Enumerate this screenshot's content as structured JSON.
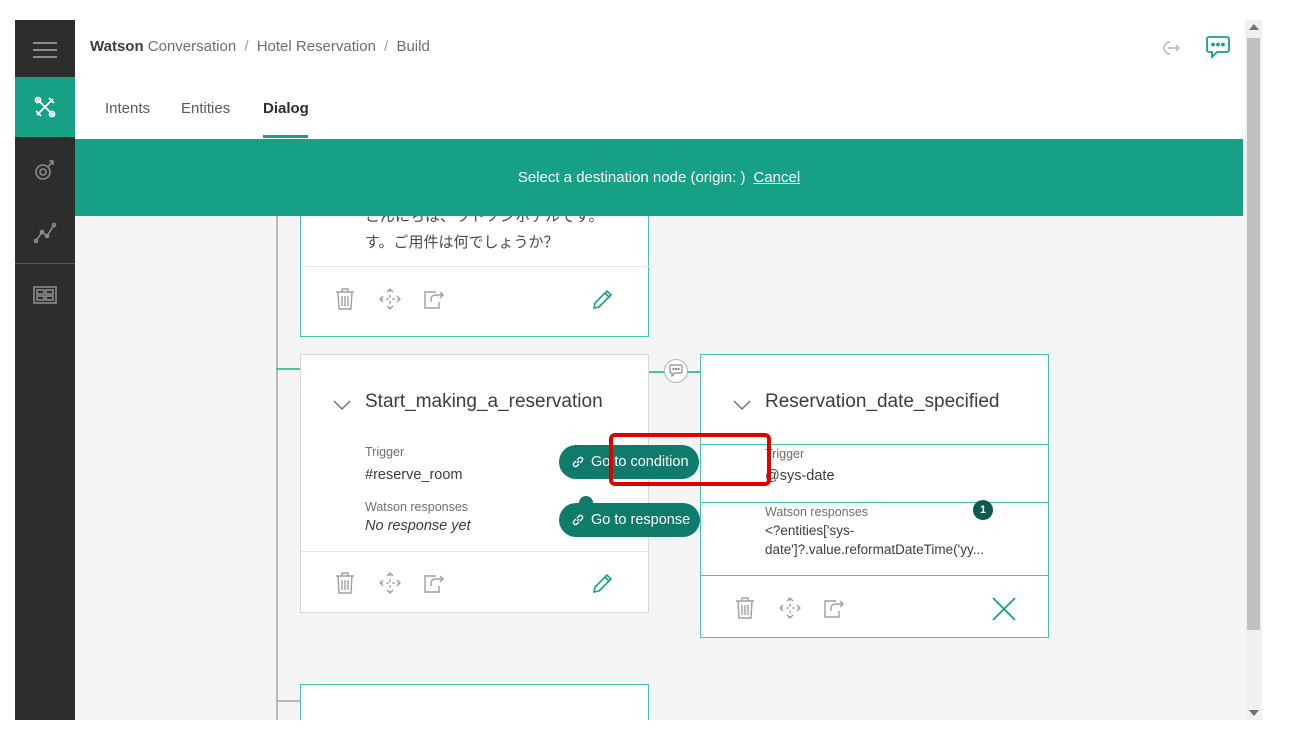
{
  "breadcrumb": {
    "brand": "Watson",
    "product": "Conversation",
    "workspace": "Hotel Reservation",
    "page": "Build",
    "separator": "/"
  },
  "tabs": [
    {
      "label": "Intents"
    },
    {
      "label": "Entities"
    },
    {
      "label": "Dialog",
      "active": true
    }
  ],
  "banner": {
    "message": "Select a destination node (origin: )",
    "cancel_label": "Cancel"
  },
  "nodes": {
    "welcome": {
      "response_line1": "こんにちは、ワトソンホテルです。",
      "response_line2": "す。ご用件は何でしょうか？"
    },
    "start": {
      "title": "Start_making_a_reservation",
      "trigger_label": "Trigger",
      "trigger_value": "#reserve_room",
      "responses_label": "Watson responses",
      "responses_value": "No response yet"
    },
    "date": {
      "title": "Reservation_date_specified",
      "trigger_label": "Trigger",
      "trigger_value": "@sys-date",
      "responses_label": "Watson responses",
      "responses_line1": "<?entities['sys-",
      "responses_line2": "date']?.value.reformatDateTime('yy...",
      "response_count": "1"
    }
  },
  "pills": {
    "go_to_condition": "Go to condition",
    "go_to_response": "Go to response"
  },
  "colors": {
    "accent": "#16a085",
    "rail": "#2d2d2d",
    "pill": "#0f7b6a",
    "highlight": "#e00000"
  },
  "icons": {
    "rail": [
      "menu-icon",
      "build-tools-icon",
      "improve-icon",
      "analytics-icon",
      "deploy-icon"
    ],
    "header": [
      "exit-icon",
      "chat-icon"
    ],
    "node_tools": [
      "trash-icon",
      "move-icon",
      "jump-to-icon",
      "edit-icon",
      "close-icon"
    ]
  }
}
